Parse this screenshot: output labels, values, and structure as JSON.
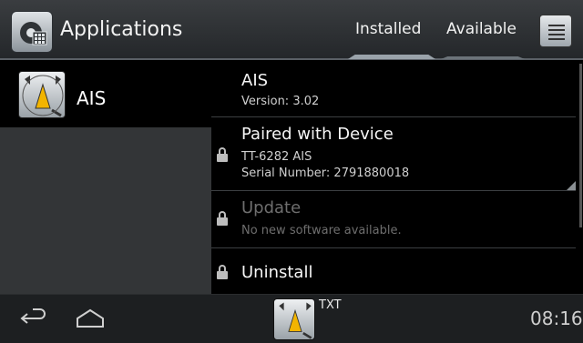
{
  "header": {
    "title": "Applications",
    "tabs": [
      {
        "label": "Installed",
        "selected": true
      },
      {
        "label": "Available",
        "selected": false
      }
    ],
    "app_icon": "applications-grid-icon",
    "menu_icon": "menu-list-icon"
  },
  "sidebar": {
    "items": [
      {
        "label": "AIS",
        "icon": "ais-radar-icon",
        "selected": true
      }
    ]
  },
  "detail": {
    "app": {
      "title": "AIS",
      "version": "Version: 3.02"
    },
    "paired": {
      "title": "Paired with Device",
      "device": "TT-6282 AIS",
      "serial": "Serial Number: 2791880018"
    },
    "update": {
      "title": "Update",
      "status": "No new software available."
    },
    "uninstall": {
      "title": "Uninstall"
    }
  },
  "navbar": {
    "notification_label": "TXT",
    "clock": "08:16"
  },
  "colors": {
    "header_bg": "#2e3134",
    "selected_item_bg": "#000000",
    "pane_bg": "#333537",
    "disabled_text": "#6e6e6e"
  }
}
